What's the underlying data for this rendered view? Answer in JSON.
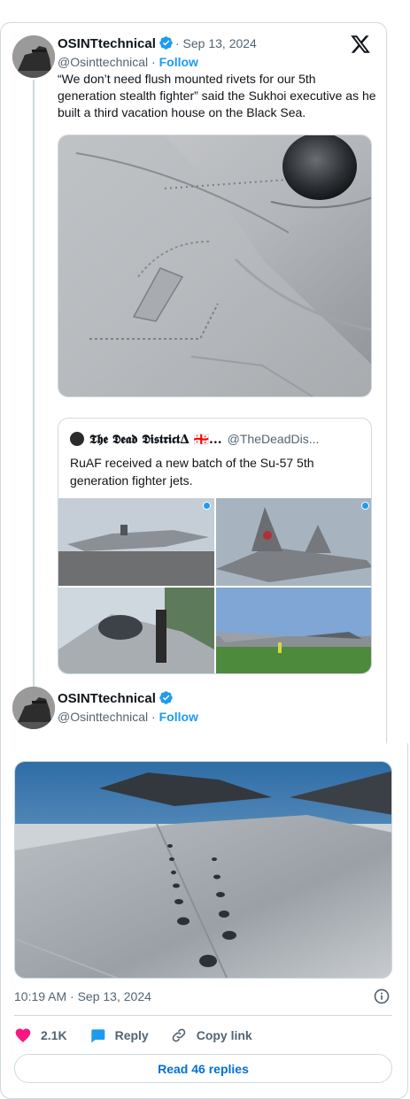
{
  "tweet1": {
    "name": "OSINTtechnical",
    "date": "· Sep 13, 2024",
    "handle": "@Osinttechnical",
    "handle_sep": " · ",
    "follow": "Follow",
    "text": "“We don’t need flush mounted rivets for our 5th generation stealth fighter” said the Sukhoi executive as he built a third vacation house on the Black Sea."
  },
  "quote": {
    "name": "𝕿𝖍𝖊 𝕯𝖊𝖆𝖉 𝕯𝖎𝖘𝖙𝖗𝖎𝖈𝖙∆ 🇬🇪...",
    "handle": "@TheDeadDis...",
    "text": "RuAF received a new batch of the Su-57 5th generation fighter jets."
  },
  "tweet2": {
    "name": "OSINTtechnical",
    "handle": "@Osinttechnical",
    "handle_sep": " · ",
    "follow": "Follow",
    "timestamp": "10:19 AM · Sep 13, 2024"
  },
  "actions": {
    "likes": "2.1K",
    "reply": "Reply",
    "copy_link": "Copy link",
    "read_replies": "Read 46 replies"
  },
  "icons": {
    "verified": "verified-badge-icon",
    "x_logo": "x-logo-icon",
    "heart": "heart-icon",
    "reply": "reply-icon",
    "link": "link-icon",
    "info": "info-icon"
  },
  "colors": {
    "accent": "#1d9bf0",
    "like": "#f91880",
    "text_secondary": "#536471",
    "border": "#cfd9de"
  }
}
